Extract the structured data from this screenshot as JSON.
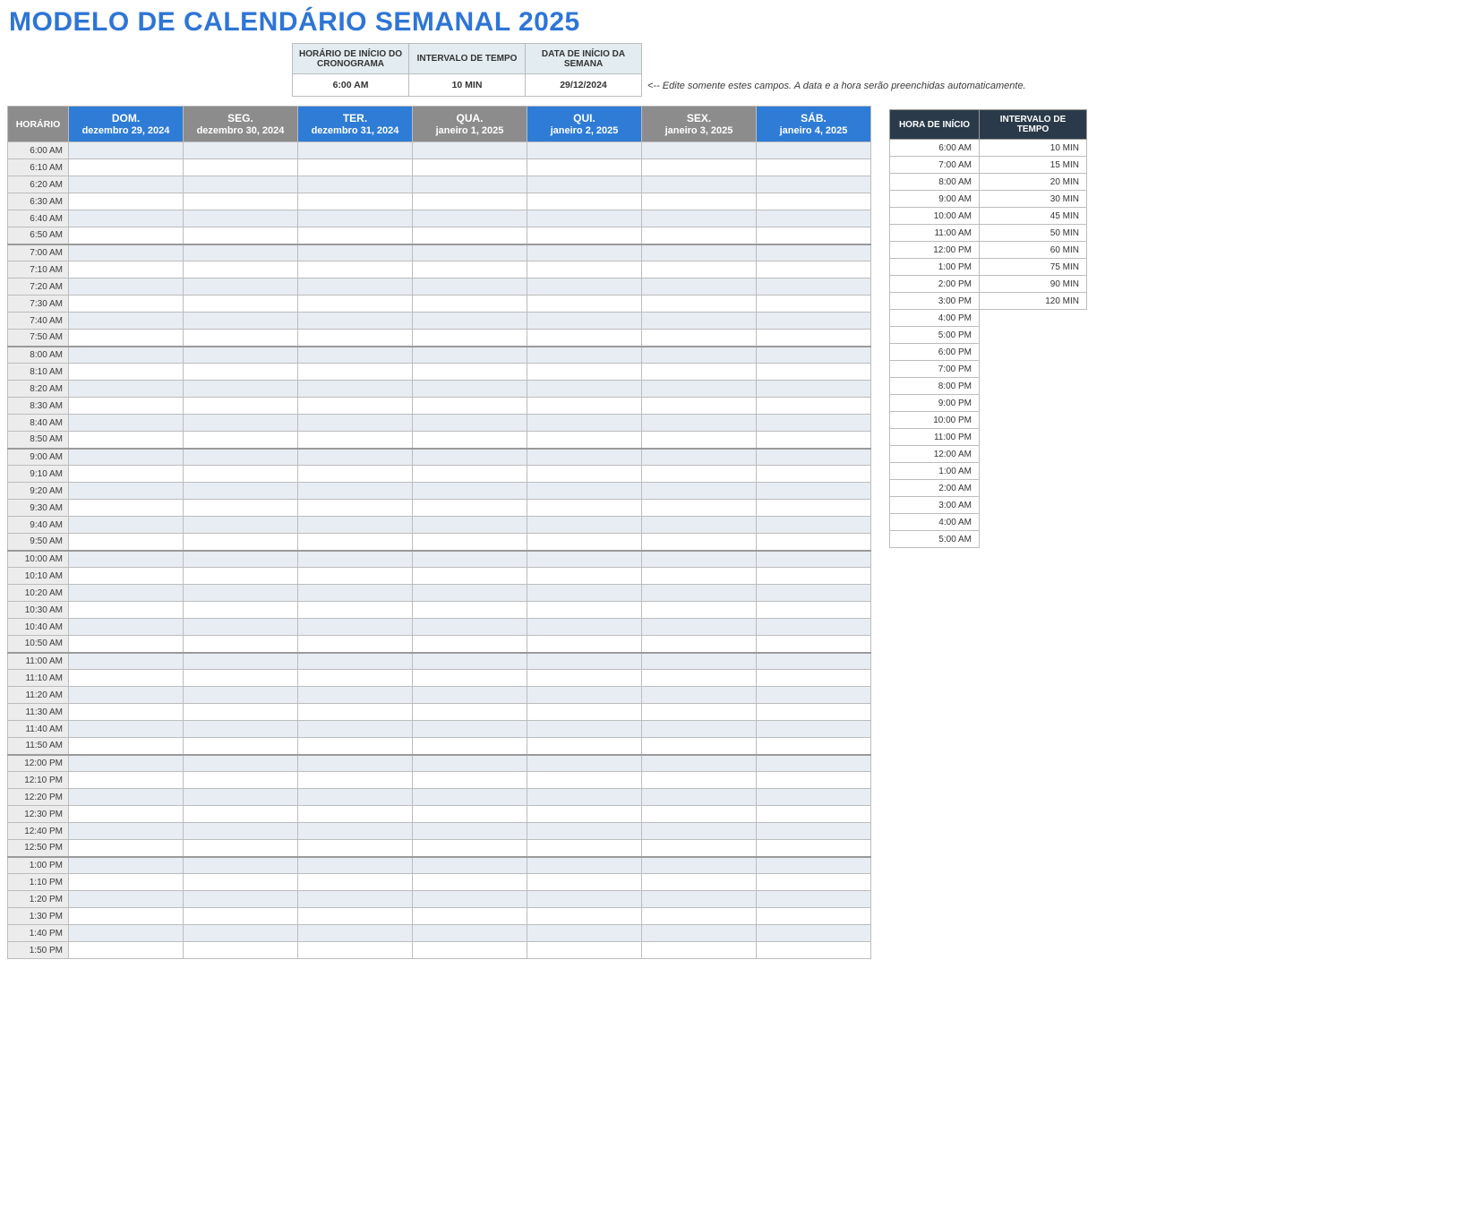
{
  "title": "MODELO DE CALENDÁRIO SEMANAL 2025",
  "config": {
    "headers": {
      "start_time": "HORÁRIO DE INÍCIO DO CRONOGRAMA",
      "interval": "INTERVALO DE TEMPO",
      "week_start": "DATA DE INÍCIO DA SEMANA"
    },
    "values": {
      "start_time": "6:00 AM",
      "interval": "10 MIN",
      "week_start": "29/12/2024"
    },
    "note": "<-- Edite somente estes campos. A data e a hora serão preenchidas automaticamente."
  },
  "schedule": {
    "time_header": "HORÁRIO",
    "days": [
      {
        "short": "DOM.",
        "long": "dezembro 29, 2024",
        "style": "blue"
      },
      {
        "short": "SEG.",
        "long": "dezembro 30, 2024",
        "style": "gray"
      },
      {
        "short": "TER.",
        "long": "dezembro 31, 2024",
        "style": "blue"
      },
      {
        "short": "QUA.",
        "long": "janeiro 1, 2025",
        "style": "gray"
      },
      {
        "short": "QUI.",
        "long": "janeiro 2, 2025",
        "style": "blue"
      },
      {
        "short": "SEX.",
        "long": "janeiro 3, 2025",
        "style": "gray"
      },
      {
        "short": "SÁB.",
        "long": "janeiro 4, 2025",
        "style": "blue"
      }
    ],
    "times": [
      "6:00 AM",
      "6:10 AM",
      "6:20 AM",
      "6:30 AM",
      "6:40 AM",
      "6:50 AM",
      "7:00 AM",
      "7:10 AM",
      "7:20 AM",
      "7:30 AM",
      "7:40 AM",
      "7:50 AM",
      "8:00 AM",
      "8:10 AM",
      "8:20 AM",
      "8:30 AM",
      "8:40 AM",
      "8:50 AM",
      "9:00 AM",
      "9:10 AM",
      "9:20 AM",
      "9:30 AM",
      "9:40 AM",
      "9:50 AM",
      "10:00 AM",
      "10:10 AM",
      "10:20 AM",
      "10:30 AM",
      "10:40 AM",
      "10:50 AM",
      "11:00 AM",
      "11:10 AM",
      "11:20 AM",
      "11:30 AM",
      "11:40 AM",
      "11:50 AM",
      "12:00 PM",
      "12:10 PM",
      "12:20 PM",
      "12:30 PM",
      "12:40 PM",
      "12:50 PM",
      "1:00 PM",
      "1:10 PM",
      "1:20 PM",
      "1:30 PM",
      "1:40 PM",
      "1:50 PM"
    ]
  },
  "reference": {
    "headers": {
      "start": "HORA DE INÍCIO",
      "interval": "INTERVALO DE TEMPO"
    },
    "start_times": [
      "6:00 AM",
      "7:00 AM",
      "8:00 AM",
      "9:00 AM",
      "10:00 AM",
      "11:00 AM",
      "12:00 PM",
      "1:00 PM",
      "2:00 PM",
      "3:00 PM",
      "4:00 PM",
      "5:00 PM",
      "6:00 PM",
      "7:00 PM",
      "8:00 PM",
      "9:00 PM",
      "10:00 PM",
      "11:00 PM",
      "12:00 AM",
      "1:00 AM",
      "2:00 AM",
      "3:00 AM",
      "4:00 AM",
      "5:00 AM"
    ],
    "intervals": [
      "10 MIN",
      "15 MIN",
      "20 MIN",
      "30 MIN",
      "45 MIN",
      "50 MIN",
      "60 MIN",
      "75 MIN",
      "90 MIN",
      "120 MIN"
    ]
  }
}
